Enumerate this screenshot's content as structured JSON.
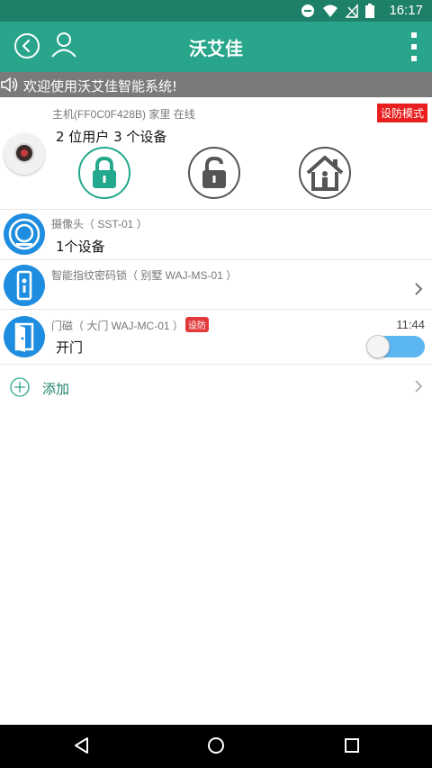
{
  "status_bar": {
    "time": "16:17"
  },
  "app_bar": {
    "title": "沃艾佳"
  },
  "notice": {
    "text": "欢迎使用沃艾佳智能系统!"
  },
  "host": {
    "info": "主机(FF0C0F428B) 家里 在线",
    "mode_badge": "设防模式",
    "summary": "2 位用户  3 个设备",
    "controls": [
      "arm-lock",
      "disarm-unlock",
      "home-mode"
    ]
  },
  "devices": [
    {
      "name": "摄像头（ SST-01 ）",
      "status": "1个设备",
      "icon": "camera-icon"
    },
    {
      "name": "智能指纹密码锁（ 别墅 WAJ-MS-01 ）",
      "status": "",
      "icon": "door-lock-icon"
    },
    {
      "name": "门磁（ 大门 WAJ-MC-01 ）",
      "badge": "设防",
      "status": "开门",
      "time": "11:44",
      "icon": "door-sensor-icon"
    }
  ],
  "add": {
    "label": "添加"
  },
  "colors": {
    "primary": "#28a58b",
    "status_bar": "#1e8068",
    "alert": "#e91e1e",
    "device_icon": "#1f8ddf",
    "toggle": "#5cb7f0"
  }
}
